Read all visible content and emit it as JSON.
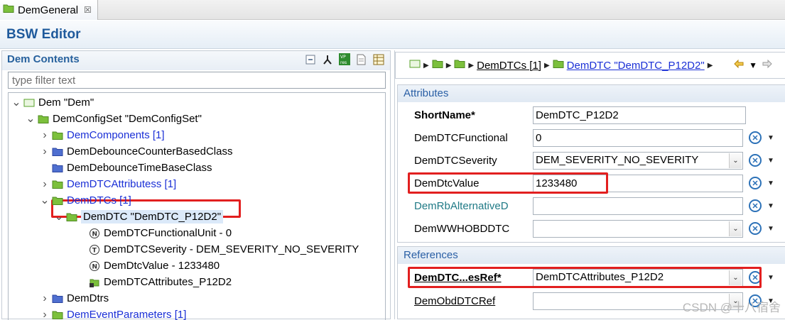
{
  "tab": {
    "title": "DemGeneral",
    "close": "☒"
  },
  "editor": {
    "title": "BSW Editor"
  },
  "left": {
    "title": "Dem Contents",
    "filter_placeholder": "type filter text",
    "tree": [
      {
        "label": "Dem \"Dem\"",
        "arrow": "v",
        "icon": "module-icon",
        "link": false
      },
      {
        "label": "DemConfigSet \"DemConfigSet\"",
        "arrow": "v",
        "icon": "folder-icon",
        "link": false
      },
      {
        "label": "DemComponents [1]",
        "arrow": ">",
        "icon": "folder-icon",
        "link": true
      },
      {
        "label": "DemDebounceCounterBasedClass",
        "arrow": ">",
        "icon": "blue-folder-icon",
        "link": false
      },
      {
        "label": "DemDebounceTimeBaseClass",
        "arrow": "",
        "icon": "blue-folder-icon",
        "link": false
      },
      {
        "label": "DemDTCAttributess [1]",
        "arrow": ">",
        "icon": "folder-icon",
        "link": true
      },
      {
        "label": "DemDTCs [1]",
        "arrow": "v",
        "icon": "folder-icon",
        "link": true
      },
      {
        "label": "DemDTC \"DemDTC_P12D2\"",
        "arrow": "v",
        "icon": "folder-icon",
        "link": false
      },
      {
        "label": "DemDTCFunctionalUnit - 0",
        "arrow": "",
        "icon": "integer-param-icon",
        "link": false
      },
      {
        "label": "DemDTCSeverity - DEM_SEVERITY_NO_SEVERITY",
        "arrow": "",
        "icon": "enum-param-icon",
        "link": false
      },
      {
        "label": "DemDtcValue - 1233480",
        "arrow": "",
        "icon": "integer-param-icon",
        "link": false
      },
      {
        "label": "DemDTCAttributes_P12D2",
        "arrow": "",
        "icon": "reference-icon",
        "link": false
      },
      {
        "label": "DemDtrs",
        "arrow": ">",
        "icon": "blue-folder-icon",
        "link": false
      },
      {
        "label": "DemEventParameters [1]",
        "arrow": ">",
        "icon": "folder-icon",
        "link": true
      }
    ]
  },
  "right": {
    "breadcrumb": {
      "dtcs": "DemDTCs [1]",
      "dtc": "DemDTC \"DemDTC_P12D2\""
    },
    "attributes": {
      "title": "Attributes",
      "short_name_label": "ShortName*",
      "short_name_value": "DemDTC_P12D2",
      "functional_label": "DemDTCFunctional",
      "functional_value": "0",
      "severity_label": "DemDTCSeverity",
      "severity_value": "DEM_SEVERITY_NO_SEVERITY",
      "dtc_value_label": "DemDtcValue",
      "dtc_value_value": "1233480",
      "alt_label": "DemRbAlternativeD",
      "alt_value": "",
      "wwh_label": "DemWWHOBDDTC",
      "wwh_value": ""
    },
    "references": {
      "title": "References",
      "attr_ref_label": "DemDTC...esRef*",
      "attr_ref_value": "DemDTCAttributes_P12D2",
      "obd_ref_label": "DemObdDTCRef",
      "obd_ref_value": ""
    }
  },
  "watermark": "CSDN @十八宿舍",
  "colors": {
    "highlight": "#e21f1f",
    "link": "#1a2fd6",
    "section_title": "#2a5fa5"
  }
}
